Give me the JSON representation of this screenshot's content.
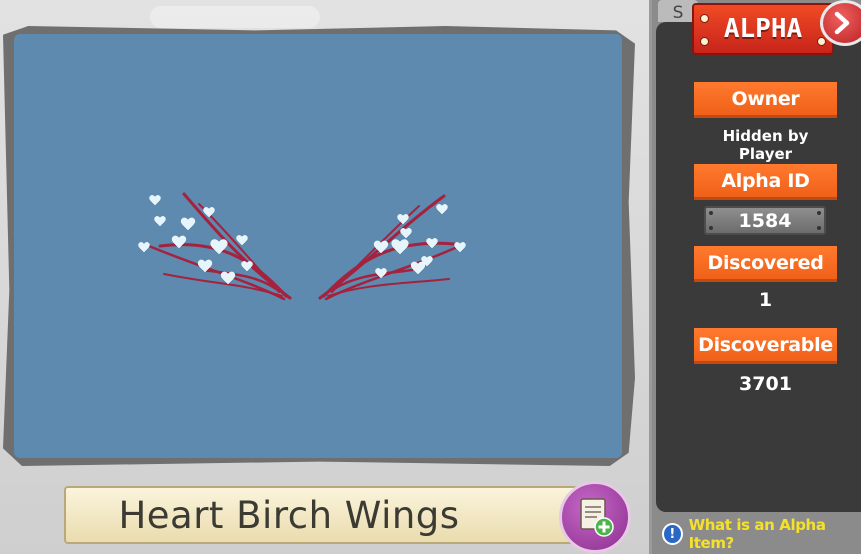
{
  "item": {
    "name": "Heart Birch Wings",
    "preview_background": "#5d8aae"
  },
  "panel": {
    "badge": "ALPHA",
    "behind_tab": "S",
    "owner_label": "Owner",
    "owner_value": "Hidden by Player",
    "alpha_id_label": "Alpha ID",
    "alpha_id_value": "1584",
    "discovered_label": "Discovered",
    "discovered_value": "1",
    "discoverable_label": "Discoverable",
    "discoverable_value": "3701",
    "help_link": "What is an Alpha Item?"
  },
  "icons": {
    "close": "close-chevron-icon",
    "add": "add-to-list-icon",
    "info": "info-icon"
  },
  "colors": {
    "accent_orange": "#f06018",
    "badge_red": "#d9301e",
    "help_yellow": "#f5e12a",
    "panel_dark": "#3a3a3a"
  }
}
